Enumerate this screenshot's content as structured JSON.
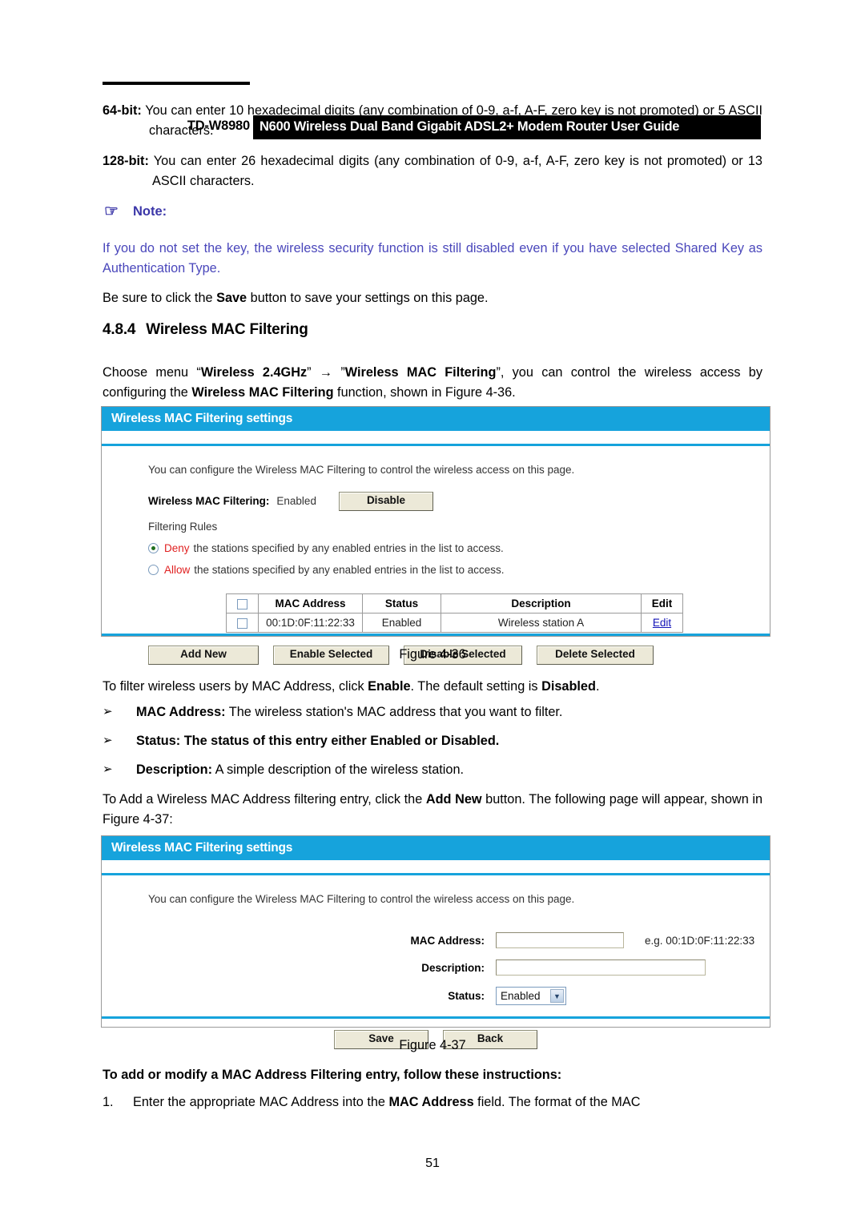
{
  "header": {
    "model": "TD-W8980",
    "title": "N600 Wireless Dual Band Gigabit ADSL2+ Modem Router User Guide"
  },
  "body": {
    "para_64bit_label": "64-bit:",
    "para_64bit_text": " You can enter 10 hexadecimal digits (any combination of 0-9, a-f, A-F, zero key is not promoted) or 5 ASCII characters.",
    "para_128bit_label": "128-bit:",
    "para_128bit_text": " You can enter 26 hexadecimal digits (any combination of 0-9, a-f, A-F, zero key is not promoted) or 13 ASCII characters.",
    "note_icon": "hand-pointing-right-icon",
    "note_glyph": "☞",
    "note_label": "Note:",
    "note_text": "If you do not set the key, the wireless security function is still disabled even if you have selected Shared Key as Authentication Type.",
    "save_hint_pre": "Be sure to click the ",
    "save_hint_bold": "Save",
    "save_hint_post": " button to save your settings on this page.",
    "section_number": "4.8.4",
    "section_title": "Wireless MAC Filtering",
    "choose_menu": {
      "p1": "Choose menu “",
      "b1": "Wireless 2.4GHz",
      "p2": "” → ”",
      "b2": "Wireless MAC Filtering",
      "p3": "”, you can control the wireless access by configuring the ",
      "b3": "Wireless MAC Filtering",
      "p4": " function, shown in Figure 4-36."
    },
    "figure_36_caption": "Figure 4-36",
    "figure_37_caption": "Figure 4-37",
    "filter_intro": {
      "p1": "To filter wireless users by MAC Address, click ",
      "b1": "Enable",
      "p2": ". The default setting is ",
      "b2": "Disabled",
      "p3": "."
    },
    "bullets": [
      {
        "marker": "➢",
        "bold": "MAC Address:",
        "text": " The wireless station's MAC address that you want to filter."
      },
      {
        "marker": "➢",
        "bold": "Status:",
        "text_pre": " The status of this entry either ",
        "bold2": "Enabled",
        "mid": " or ",
        "bold3": "Disabled",
        "text_post": "."
      },
      {
        "marker": "➢",
        "bold": "Description:",
        "text": " A simple description of the wireless station."
      }
    ],
    "add_entry": {
      "p1": "To Add a Wireless MAC Address filtering entry, click the ",
      "b1": "Add New",
      "p2": " button. The following page will appear, shown in Figure 4-37:"
    },
    "instructions_heading": "To add or modify a MAC Address Filtering entry, follow these instructions:",
    "step1": {
      "number": "1.",
      "p1": "Enter the appropriate MAC Address into the ",
      "b1": "MAC Address",
      "p2": " field. The format of the MAC"
    },
    "page_number": "51"
  },
  "panel_list": {
    "title": "Wireless MAC Filtering settings",
    "description": "You can configure the Wireless MAC Filtering to control the wireless access on this page.",
    "filter_label": "Wireless MAC Filtering:",
    "filter_value": "Enabled",
    "toggle_button": "Disable",
    "filtering_rules_label": "Filtering Rules",
    "radios": [
      {
        "selected": true,
        "word": "Deny",
        "text": " the stations specified by any enabled entries in the list to access."
      },
      {
        "selected": false,
        "word": "Allow",
        "text": " the stations specified by any enabled entries in the list to access."
      }
    ],
    "table": {
      "headers": [
        "",
        "MAC Address",
        "Status",
        "Description",
        "Edit"
      ],
      "rows": [
        {
          "mac": "00:1D:0F:11:22:33",
          "status": "Enabled",
          "description": "Wireless station A",
          "edit": "Edit"
        }
      ]
    },
    "buttons": [
      "Add New",
      "Enable Selected",
      "Disable Selected",
      "Delete Selected"
    ]
  },
  "panel_form": {
    "title": "Wireless MAC Filtering settings",
    "description": "You can configure the Wireless MAC Filtering to control the wireless access on this page.",
    "fields": {
      "mac_label": "MAC Address:",
      "mac_value": "",
      "mac_example": "e.g. 00:1D:0F:11:22:33",
      "desc_label": "Description:",
      "desc_value": "",
      "status_label": "Status:",
      "status_value": "Enabled"
    },
    "buttons": [
      "Save",
      "Back"
    ]
  },
  "colors": {
    "panel_header": "#16a3dc",
    "note_text": "#4a47bb",
    "radio_word": "#e02020",
    "link": "#1414b8"
  }
}
